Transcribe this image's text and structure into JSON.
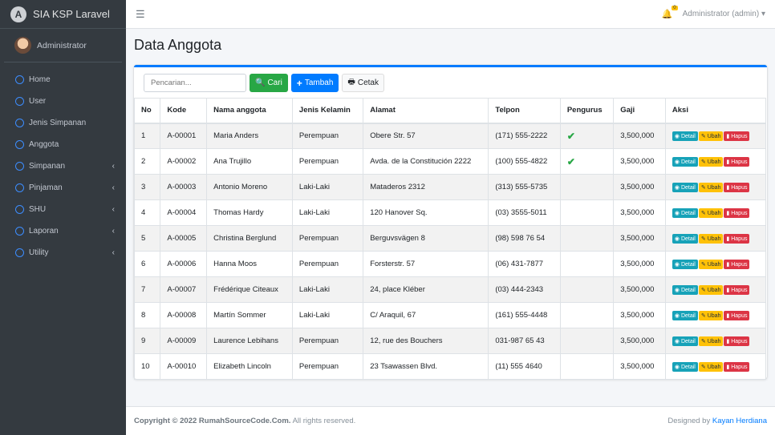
{
  "sidebar": {
    "brand": "SIA KSP Laravel",
    "logo_letter": "A",
    "user": "Administrator",
    "items": [
      {
        "label": "Home",
        "sub": false
      },
      {
        "label": "User",
        "sub": false
      },
      {
        "label": "Jenis Simpanan",
        "sub": false
      },
      {
        "label": "Anggota",
        "sub": false
      },
      {
        "label": "Simpanan",
        "sub": true
      },
      {
        "label": "Pinjaman",
        "sub": true
      },
      {
        "label": "SHU",
        "sub": true
      },
      {
        "label": "Laporan",
        "sub": true
      },
      {
        "label": "Utility",
        "sub": true
      }
    ]
  },
  "topbar": {
    "notifications": "0",
    "user_menu": "Administrator (admin)"
  },
  "page_title": "Data Anggota",
  "toolbar": {
    "search_placeholder": "Pencarian...",
    "search_label": "Cari",
    "add_label": "Tambah",
    "print_label": "Cetak"
  },
  "table": {
    "headers": [
      "No",
      "Kode",
      "Nama anggota",
      "Jenis Kelamin",
      "Alamat",
      "Telpon",
      "Pengurus",
      "Gaji",
      "Aksi"
    ],
    "actions": {
      "detail": "Detail",
      "edit": "Ubah",
      "delete": "Hapus"
    },
    "rows": [
      [
        "1",
        "A-00001",
        "Maria Anders",
        "Perempuan",
        "Obere Str. 57",
        "(171) 555-2222",
        true,
        "3,500,000"
      ],
      [
        "2",
        "A-00002",
        "Ana Trujillo",
        "Perempuan",
        "Avda. de la Constitución 2222",
        "(100) 555-4822",
        true,
        "3,500,000"
      ],
      [
        "3",
        "A-00003",
        "Antonio Moreno",
        "Laki-Laki",
        "Mataderos 2312",
        "(313) 555-5735",
        false,
        "3,500,000"
      ],
      [
        "4",
        "A-00004",
        "Thomas Hardy",
        "Laki-Laki",
        "120 Hanover Sq.",
        "(03) 3555-5011",
        false,
        "3,500,000"
      ],
      [
        "5",
        "A-00005",
        "Christina Berglund",
        "Perempuan",
        "Berguvsvägen 8",
        "(98) 598 76 54",
        false,
        "3,500,000"
      ],
      [
        "6",
        "A-00006",
        "Hanna Moos",
        "Perempuan",
        "Forsterstr. 57",
        "(06) 431-7877",
        false,
        "3,500,000"
      ],
      [
        "7",
        "A-00007",
        "Frédérique Citeaux",
        "Laki-Laki",
        "24, place Kléber",
        "(03) 444-2343",
        false,
        "3,500,000"
      ],
      [
        "8",
        "A-00008",
        "Martín Sommer",
        "Laki-Laki",
        "C/ Araquil, 67",
        "(161) 555-4448",
        false,
        "3,500,000"
      ],
      [
        "9",
        "A-00009",
        "Laurence Lebihans",
        "Perempuan",
        "12, rue des Bouchers",
        "031-987 65 43",
        false,
        "3,500,000"
      ],
      [
        "10",
        "A-00010",
        "Elizabeth Lincoln",
        "Perempuan",
        "23 Tsawassen Blvd.",
        "(11) 555 4640",
        false,
        "3,500,000"
      ]
    ]
  },
  "footer": {
    "copyright": "Copyright © 2022 RumahSourceCode.Com.",
    "rights": " All rights reserved.",
    "designed_by": "Designed by ",
    "author": "Kayan Herdiana"
  }
}
